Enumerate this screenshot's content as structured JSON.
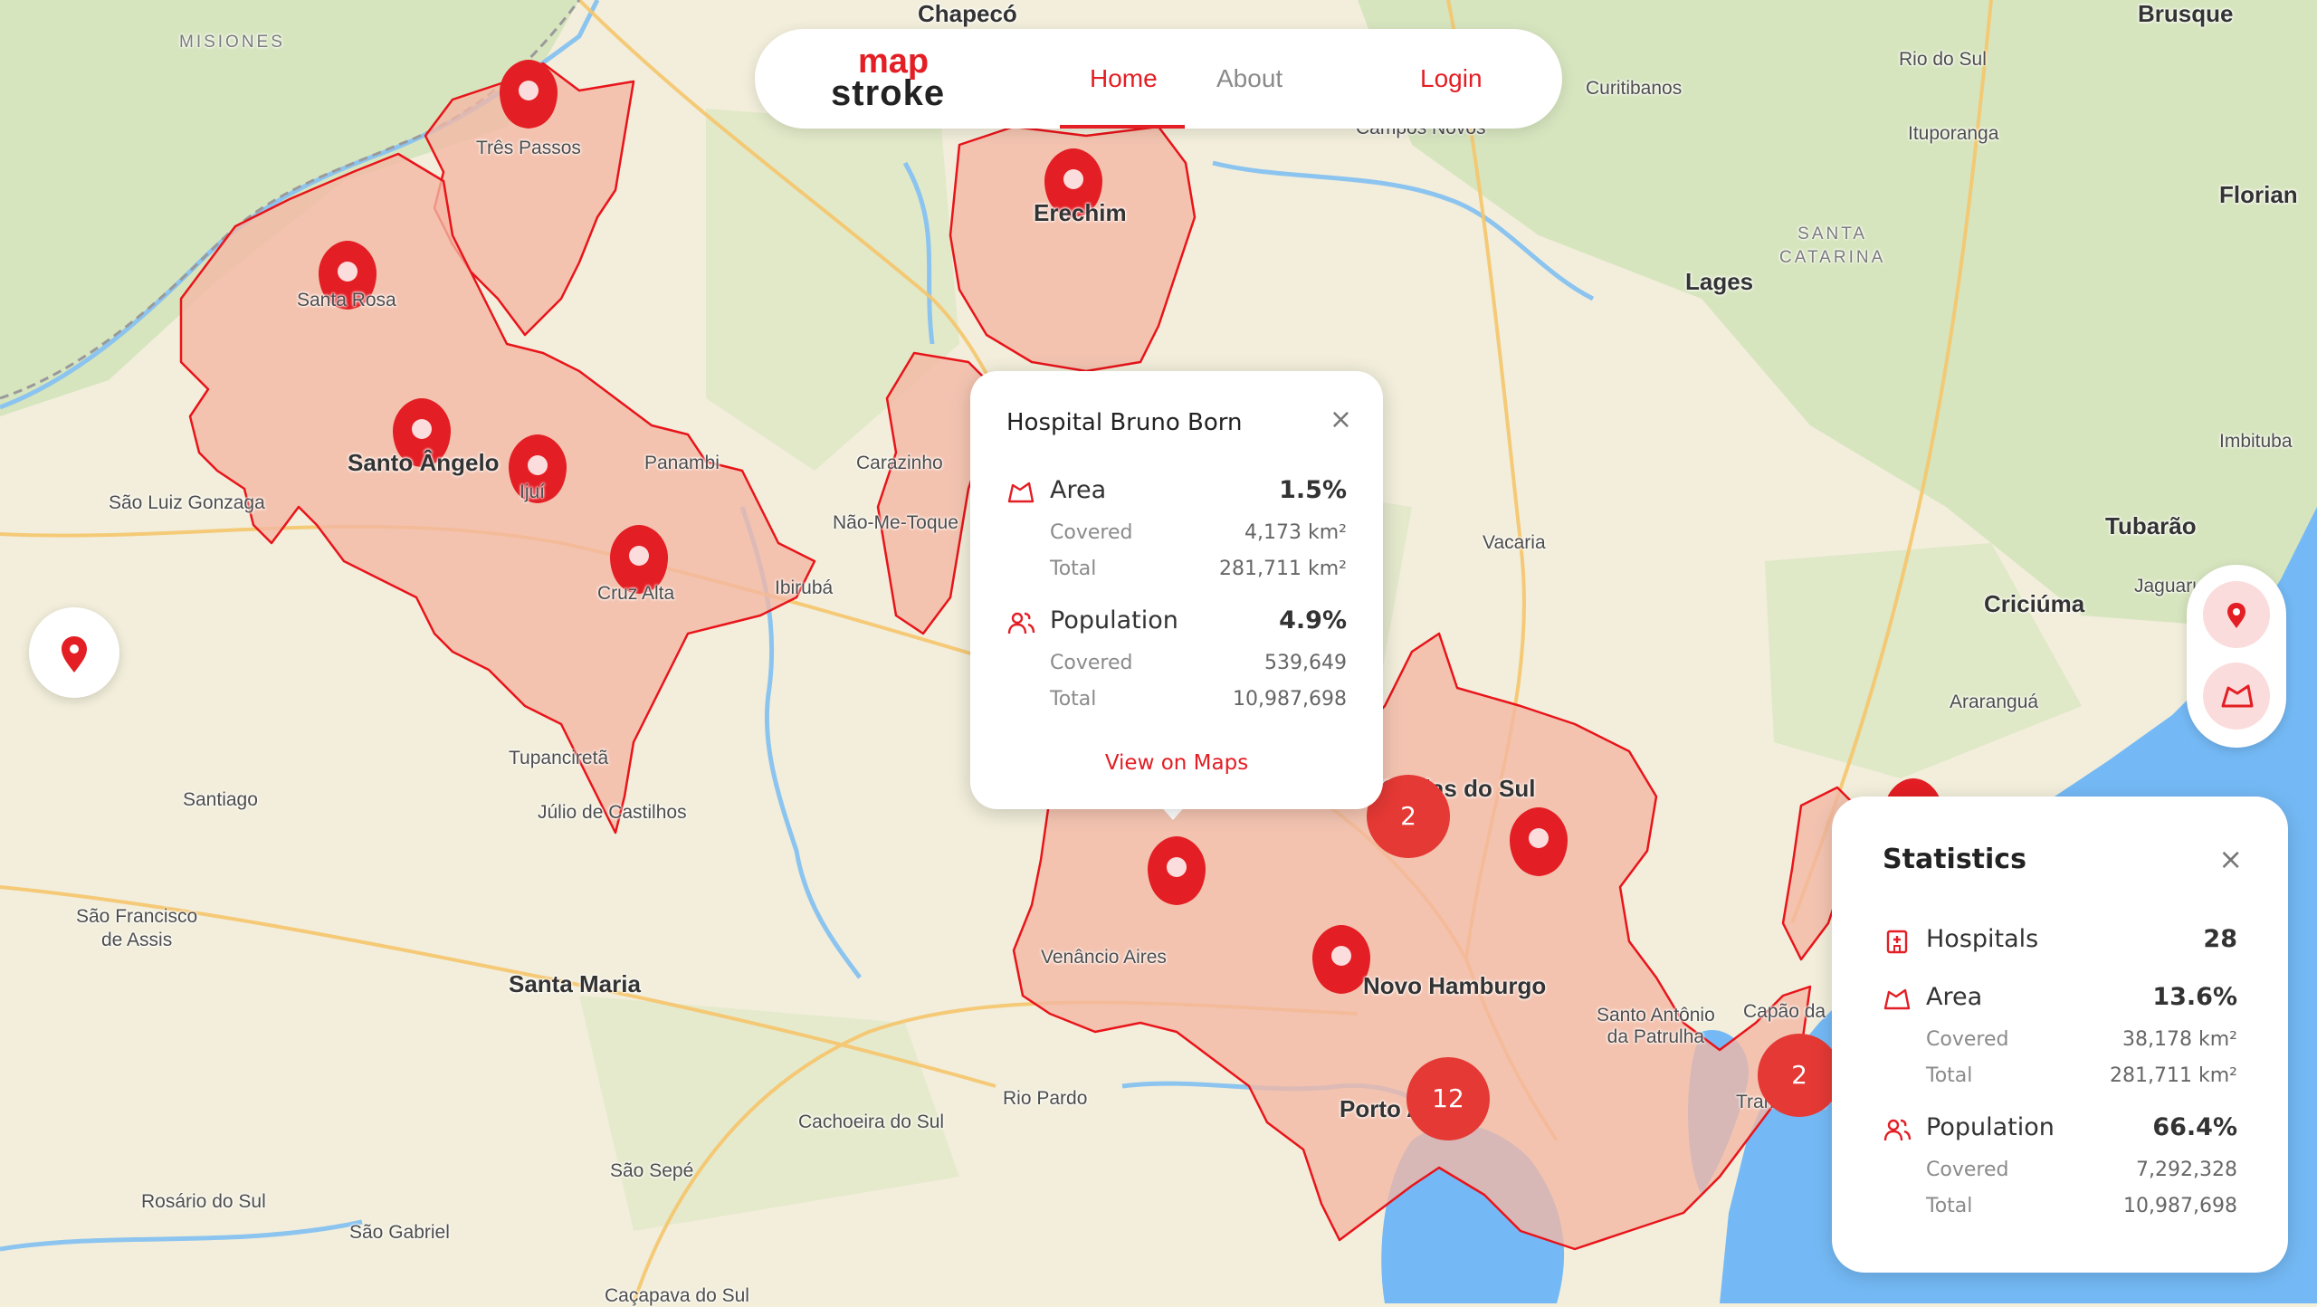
{
  "nav": {
    "logo_top": "map",
    "logo_bottom": "stroke",
    "home": "Home",
    "about": "About",
    "login": "Login"
  },
  "map_labels": {
    "chapeco": "Chapecó",
    "brusque": "Brusque",
    "misiones": "MISIONES",
    "rio_do_sul": "Rio do Sul",
    "curitibanos": "Curitibanos",
    "campos_novos": "Campos Novos",
    "ituporanga": "Ituporanga",
    "floriano": "Florian",
    "santa_catarina": "SANTA\nCATARINA",
    "lages": "Lages",
    "tres_passos": "Três Passos",
    "santa_rosa": "Santa Rosa",
    "erechim": "Erechim",
    "sao_luiz": "São Luiz Gonzaga",
    "santo_angelo": "Santo Ângelo",
    "ijui": "Ijuí",
    "panambi": "Panambi",
    "carazinho": "Carazinho",
    "nao_me_toque": "Não-Me-Toque",
    "cruz_alta": "Cruz Alta",
    "ibiruba": "Ibirubá",
    "vacaria": "Vacaria",
    "imbituba": "Imbituba",
    "tubarao": "Tubarão",
    "jaguaruna": "Jaguaruna",
    "criciuma": "Criciúma",
    "ararangua": "Araranguá",
    "tupancireta": "Tupanciretã",
    "julio": "Júlio de Castilhos",
    "santiago": "Santiago",
    "caxias": "Caxias do Sul",
    "sao_francisco": "São Francisco\nde Assis",
    "santa_maria": "Santa Maria",
    "venancio": "Venâncio Aires",
    "novo_hamburgo": "Novo Hamburgo",
    "santo_antonio": "Santo Antônio\nda Patrulha",
    "capao": "Capão da",
    "rio_pardo": "Rio Pardo",
    "cachoeira": "Cachoeira do Sul",
    "porto_alegre": "Porto Alegre",
    "tramandai": "Tramandaí",
    "sao_sepe": "São Sepé",
    "rosario": "Rosário do Sul",
    "sao_gabriel": "São Gabriel",
    "cacapava": "Caçapava do Sul"
  },
  "clusters": {
    "c1": "2",
    "c2": "12",
    "c3": "2"
  },
  "popup": {
    "title": "Hospital Bruno Born",
    "area_label": "Area",
    "area_pct": "1.5%",
    "area_covered_label": "Covered",
    "area_covered": "4,173 km²",
    "area_total_label": "Total",
    "area_total": "281,711 km²",
    "pop_label": "Population",
    "pop_pct": "4.9%",
    "pop_covered_label": "Covered",
    "pop_covered": "539,649",
    "pop_total_label": "Total",
    "pop_total": "10,987,698",
    "link": "View on Maps"
  },
  "stats": {
    "title": "Statistics",
    "hospitals_label": "Hospitals",
    "hospitals": "28",
    "area_label": "Area",
    "area_pct": "13.6%",
    "area_covered_label": "Covered",
    "area_covered": "38,178 km²",
    "area_total_label": "Total",
    "area_total": "281,711 km²",
    "pop_label": "Population",
    "pop_pct": "66.4%",
    "pop_covered_label": "Covered",
    "pop_covered": "7,292,328",
    "pop_total_label": "Total",
    "pop_total": "10,987,698"
  },
  "colors": {
    "accent": "#e31e24",
    "coverage_fill": "#f4b7a4",
    "coverage_stroke": "#e8141a",
    "sea": "#74b9f5",
    "land": "#f3efd9",
    "forest": "#cfe0b6"
  }
}
